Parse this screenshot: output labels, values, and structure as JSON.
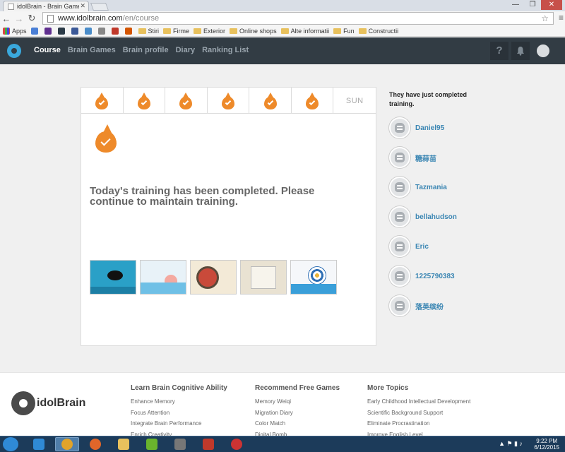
{
  "browser": {
    "tab_title": "idolBrain - Brain Games &",
    "url_host": "www.idolbrain.com",
    "url_path": "/en/course",
    "bookmarks": [
      {
        "label": "Apps",
        "type": "apps"
      },
      {
        "label": "",
        "type": "icon",
        "color": "#4a7fd6"
      },
      {
        "label": "",
        "type": "icon",
        "color": "#5f2f8f"
      },
      {
        "label": "",
        "type": "icon",
        "color": "#2b3a47"
      },
      {
        "label": "",
        "type": "icon",
        "color": "#3b5998"
      },
      {
        "label": "",
        "type": "icon",
        "color": "#4a8cc9"
      },
      {
        "label": "",
        "type": "icon",
        "color": "#888888"
      },
      {
        "label": "",
        "type": "icon",
        "color": "#c0392b"
      },
      {
        "label": "",
        "type": "icon",
        "color": "#d35400"
      },
      {
        "label": "Stiri",
        "type": "folder"
      },
      {
        "label": "Firme",
        "type": "folder"
      },
      {
        "label": "Exterior",
        "type": "folder"
      },
      {
        "label": "Online shops",
        "type": "folder"
      },
      {
        "label": "Alte informatii",
        "type": "folder"
      },
      {
        "label": "Fun",
        "type": "folder"
      },
      {
        "label": "Constructii",
        "type": "folder"
      }
    ]
  },
  "header": {
    "nav": [
      "Course",
      "Brain Games",
      "Brain profile",
      "Diary",
      "Ranking List"
    ],
    "active_nav": "Course",
    "help_label": "?"
  },
  "week": {
    "completed_days": 6,
    "last_day_label": "SUN"
  },
  "main": {
    "message": "Today's training has been completed. Please continue to maintain training."
  },
  "games": [
    {
      "name": "fish",
      "bg": "#2aa0c7"
    },
    {
      "name": "boats",
      "bg": "#e8f2f8"
    },
    {
      "name": "stamp",
      "bg": "#f3ead7"
    },
    {
      "name": "puzzle",
      "bg": "#e9e2d2"
    },
    {
      "name": "target",
      "bg": "#f5f7fa"
    }
  ],
  "sidebar": {
    "title": "They have just completed training.",
    "users": [
      "Daniel95",
      "糖蒜苗",
      "Tazmania",
      "bellahudson",
      "Eric",
      "1225790383",
      "落英缤纷"
    ]
  },
  "footer": {
    "logo_text": "idolBrain",
    "columns": [
      {
        "heading": "Learn Brain Cognitive Ability",
        "links": [
          "Enhance Memory",
          "Focus Attention",
          "Integrate Brain Performance",
          "Enrich Creativity"
        ]
      },
      {
        "heading": "Recommend Free Games",
        "links": [
          "Memory Weiqi",
          "Migration Diary",
          "Color Match",
          "Digital Bomb"
        ]
      },
      {
        "heading": "More Topics",
        "links": [
          "Early Childhood Intellectual Development",
          "Scientific Background Support",
          "Eliminate Procrastination",
          "Improve English Level"
        ]
      }
    ]
  },
  "taskbar": {
    "time": "9:22 PM",
    "date": "6/12/2015",
    "apps": [
      {
        "name": "ie",
        "color": "#2f8ad6"
      },
      {
        "name": "chrome",
        "color": "#e0a32a"
      },
      {
        "name": "firefox",
        "color": "#e0662a"
      },
      {
        "name": "explorer",
        "color": "#e8c15d"
      },
      {
        "name": "nvidia",
        "color": "#6ab42d"
      },
      {
        "name": "m-app",
        "color": "#777777"
      },
      {
        "name": "120x",
        "color": "#c0392b"
      },
      {
        "name": "opera",
        "color": "#cc3333"
      }
    ]
  }
}
